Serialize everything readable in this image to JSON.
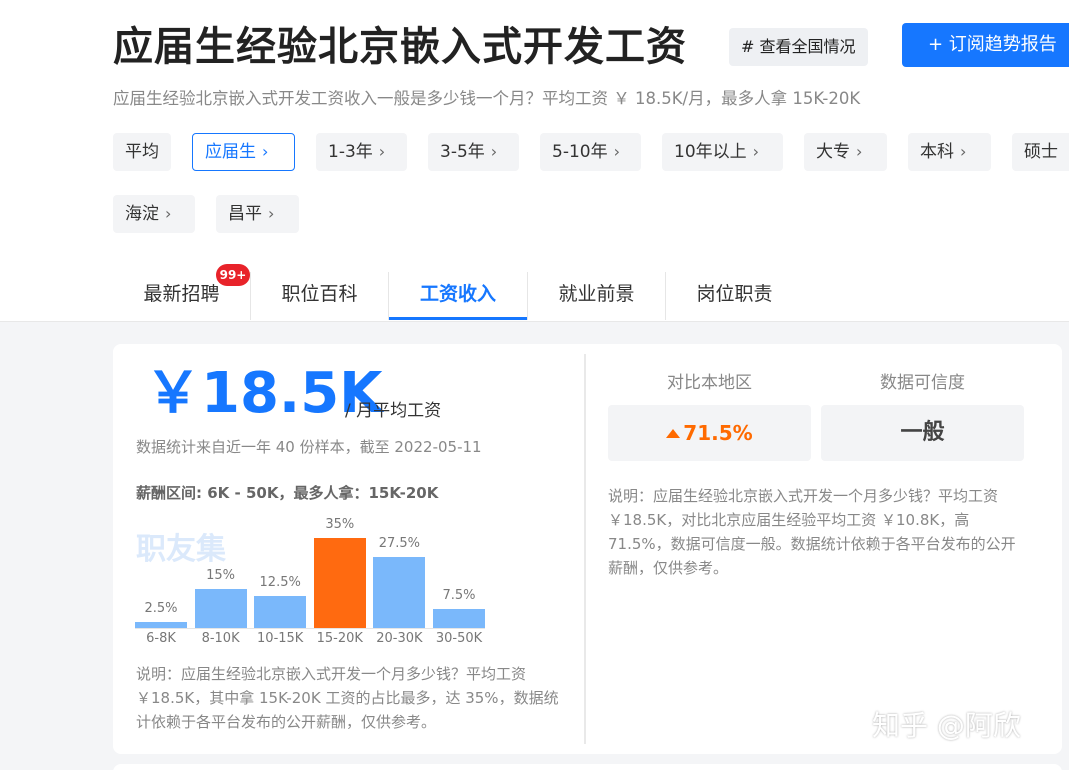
{
  "header": {
    "title": "应届生经验北京嵌入式开发工资",
    "national_button": "# 查看全国情况",
    "subscribe_button": "+ 订阅趋势报告",
    "subtitle": "应届生经验北京嵌入式开发工资收入一般是多少钱一个月？平均工资 ￥ 18.5K/月，最多人拿 15K-20K"
  },
  "filters": [
    {
      "label": "平均",
      "chevron": false,
      "active": false
    },
    {
      "label": "应届生",
      "chevron": true,
      "active": true
    },
    {
      "label": "1-3年",
      "chevron": true,
      "active": false
    },
    {
      "label": "3-5年",
      "chevron": true,
      "active": false
    },
    {
      "label": "5-10年",
      "chevron": true,
      "active": false
    },
    {
      "label": "10年以上",
      "chevron": true,
      "active": false
    },
    {
      "label": "大专",
      "chevron": true,
      "active": false
    },
    {
      "label": "本科",
      "chevron": true,
      "active": false
    },
    {
      "label": "硕士",
      "chevron": false,
      "active": false
    },
    {
      "label": "海淀",
      "chevron": true,
      "active": false
    },
    {
      "label": "昌平",
      "chevron": true,
      "active": false
    }
  ],
  "tabs": [
    {
      "label": "最新招聘",
      "active": false
    },
    {
      "label": "职位百科",
      "active": false
    },
    {
      "label": "工资收入",
      "active": true
    },
    {
      "label": "就业前景",
      "active": false
    },
    {
      "label": "岗位职责",
      "active": false
    }
  ],
  "badge": "99+",
  "salary": {
    "amount": "￥18.5K",
    "unit": "/ 月平均工资",
    "stat_note": "数据统计来自近一年 40 份样本，截至 2022-05-11",
    "range_text": "薪酬区间: 6K - 50K，最多人拿：15K-20K",
    "watermark": "职友集",
    "description": "说明：应届生经验北京嵌入式开发一个月多少钱？平均工资 ￥18.5K，其中拿 15K-20K 工资的占比最多，达 35%，数据统计依赖于各平台发布的公开薪酬，仅供参考。"
  },
  "chart_data": {
    "type": "bar",
    "categories": [
      "6-8K",
      "8-10K",
      "10-15K",
      "15-20K",
      "20-30K",
      "30-50K"
    ],
    "values": [
      2.5,
      15,
      12.5,
      35,
      27.5,
      7.5
    ],
    "value_labels": [
      "2.5%",
      "15%",
      "12.5%",
      "35%",
      "27.5%",
      "7.5%"
    ],
    "highlight_index": 3,
    "colors": {
      "normal": "#7ab8fb",
      "highlight": "#ff6a10"
    },
    "ylim": [
      0,
      35
    ]
  },
  "comparison": {
    "region_title": "对比本地区",
    "region_value": "71.5%",
    "credibility_title": "数据可信度",
    "credibility_value": "一般",
    "description": "说明：应届生经验北京嵌入式开发一个月多少钱？平均工资 ￥18.5K，对比北京应届生经验平均工资 ￥10.8K，高 71.5%，数据可信度一般。数据统计依赖于各平台发布的公开薪酬，仅供参考。"
  },
  "footer_watermark": "知乎 @阿欣",
  "colors": {
    "accent": "#1677ff",
    "highlight": "#ff6a00",
    "badge": "#e8232a"
  }
}
